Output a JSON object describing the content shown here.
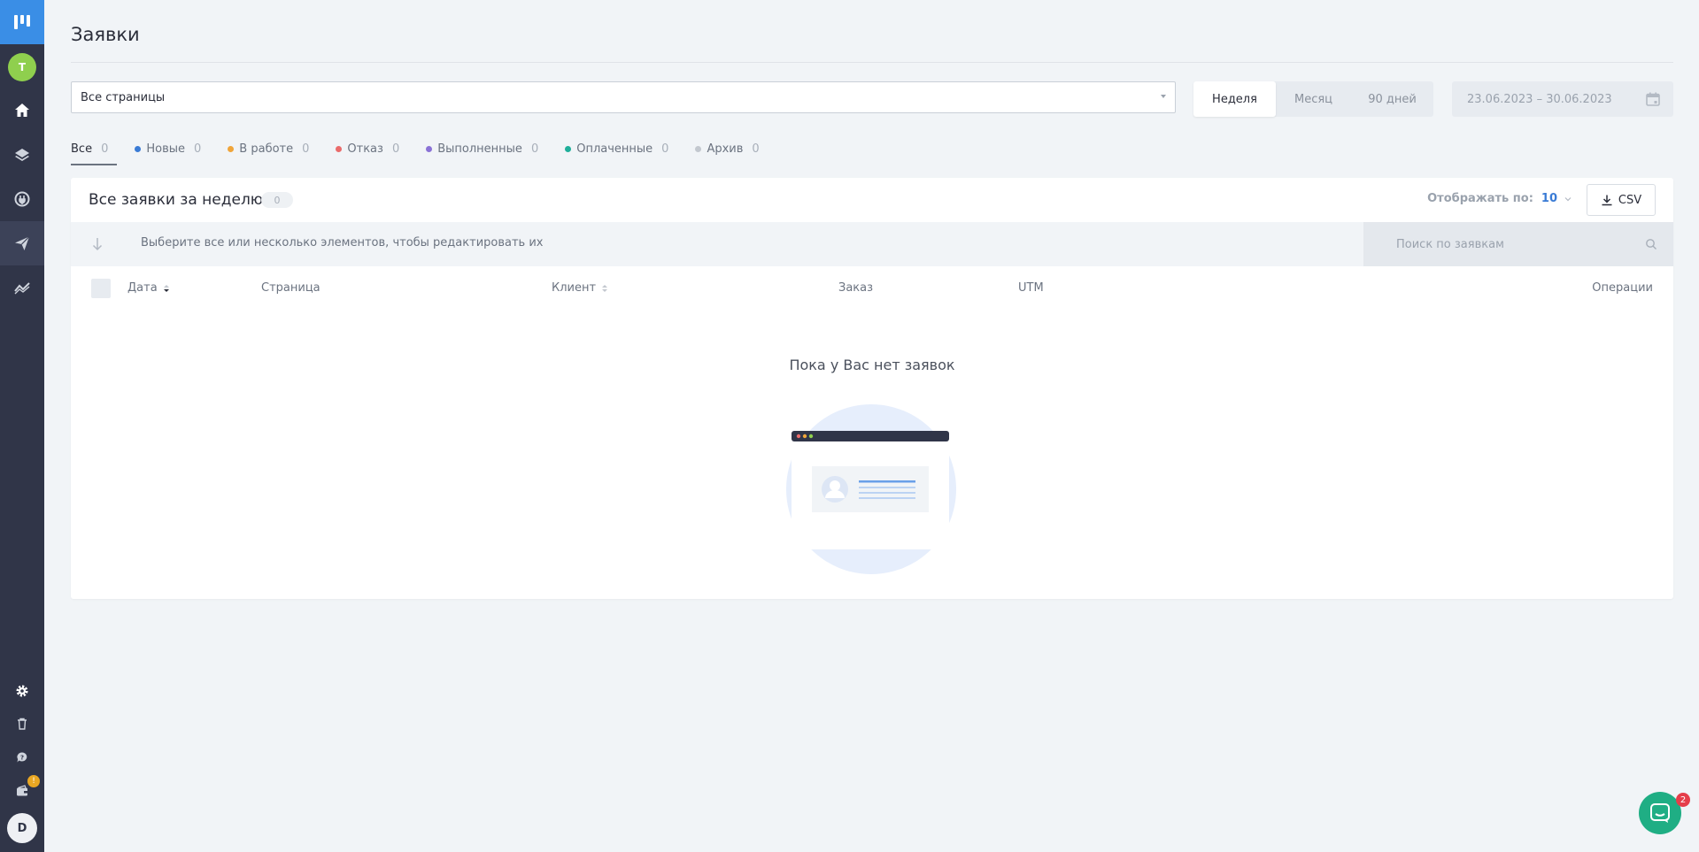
{
  "sidebar": {
    "logo_icon": "logo-bars-icon",
    "avatar_top": "T",
    "items": [
      {
        "name": "home",
        "icon": "home-icon"
      },
      {
        "name": "layers",
        "icon": "layers-icon"
      },
      {
        "name": "integrations",
        "icon": "plug-icon"
      },
      {
        "name": "leads",
        "icon": "paper-plane-icon",
        "active": true
      },
      {
        "name": "analytics",
        "icon": "chart-icon"
      }
    ],
    "bottom": [
      {
        "name": "settings",
        "icon": "gear-icon"
      },
      {
        "name": "trash",
        "icon": "trash-icon"
      },
      {
        "name": "help",
        "icon": "help-icon"
      },
      {
        "name": "wallet",
        "icon": "wallet-icon",
        "badge": "!"
      }
    ],
    "avatar_bottom": "D"
  },
  "header": {
    "title": "Заявки"
  },
  "filters_bar": {
    "page_select_value": "Все страницы",
    "periods": [
      "Неделя",
      "Месяц",
      "90 дней"
    ],
    "active_period": "Неделя",
    "date_range": "23.06.2023 – 30.06.2023"
  },
  "status_tabs": [
    {
      "label": "Все",
      "count": "0",
      "color": null,
      "active": true
    },
    {
      "label": "Новые",
      "count": "0",
      "color": "#3a7bd5"
    },
    {
      "label": "В работе",
      "count": "0",
      "color": "#f0a53a"
    },
    {
      "label": "Отказ",
      "count": "0",
      "color": "#ea6b6b"
    },
    {
      "label": "Выполненные",
      "count": "0",
      "color": "#8a72d6"
    },
    {
      "label": "Оплаченные",
      "count": "0",
      "color": "#1fae9a"
    },
    {
      "label": "Архив",
      "count": "0",
      "color": "#c3c8cf"
    }
  ],
  "card": {
    "title": "Все заявки за неделю",
    "count": "0",
    "per_page_label": "Отображать по:",
    "per_page_value": "10",
    "csv_label": "CSV",
    "toolbar_hint": "Выберите все или несколько элементов, чтобы редактировать их",
    "search_placeholder": "Поиск по заявкам",
    "columns": {
      "date": "Дата",
      "page": "Страница",
      "client": "Клиент",
      "order": "Заказ",
      "utm": "UTM",
      "operations": "Операции"
    },
    "empty_text": "Пока у Вас нет заявок"
  },
  "chat": {
    "icon": "chat-icon",
    "badge": "2"
  },
  "colors": {
    "sidebar_bg": "#303548",
    "logo_bg": "#3a8ee6",
    "accent": "#3a7bd5",
    "chat": "#1fae84"
  }
}
